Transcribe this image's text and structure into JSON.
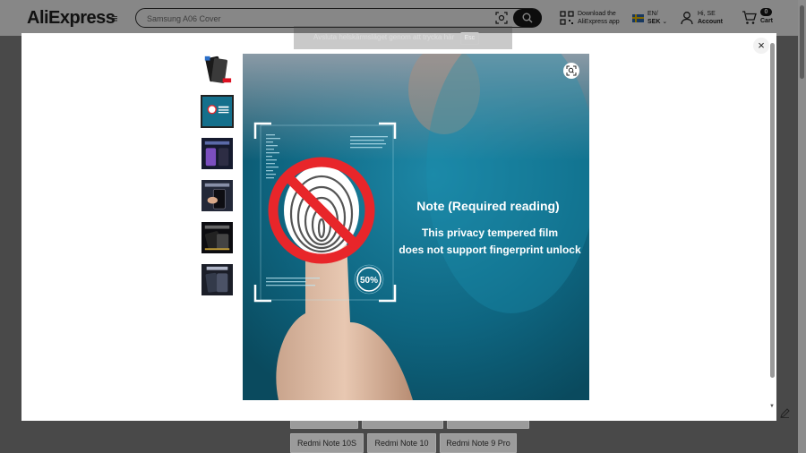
{
  "header": {
    "logo": "AliExpress",
    "search_placeholder": "Samsung A06 Cover",
    "app_download": "Download the AliExpress app",
    "lang_line1": "EN/",
    "lang_line2": "SEK",
    "account_line1": "Hi, SE",
    "account_line2": "Account",
    "cart_count": "0",
    "cart_label": "Cart"
  },
  "toast": {
    "text": "Avsluta helskärmsläget genom att trycka här",
    "key": "Esc"
  },
  "page": {
    "chips_row2": [
      "Redmi Note 10S",
      "Redmi Note 10",
      "Redmi Note 9 Pro"
    ]
  },
  "modal": {
    "close_label": "×",
    "image": {
      "heading": "Note (Required reading)",
      "line1": "This privacy tempered film",
      "line2": "does not support fingerprint unlock",
      "badge": "50%"
    },
    "thumbnails": 6,
    "active_thumbnail": 2
  },
  "colors": {
    "accent": "#191919",
    "no_symbol": "#e8262a",
    "image_bg": "#0f6a86"
  }
}
